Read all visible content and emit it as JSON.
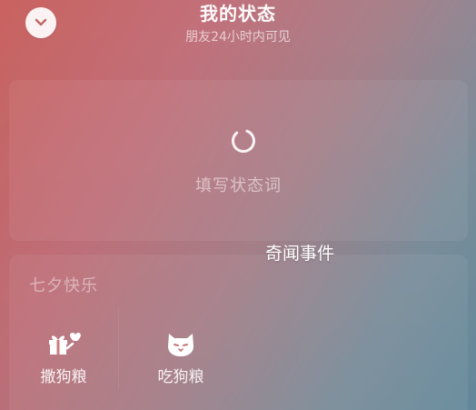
{
  "header": {
    "title": "我的状态",
    "subtitle": "朋友24小时内可见"
  },
  "collapse_button": {
    "icon": "chevron-down-icon"
  },
  "status_card": {
    "placeholder": "填写状态词",
    "icon": "loading-spinner-icon"
  },
  "watermark": "奇闻事件",
  "festival": {
    "title": "七夕快乐",
    "actions": [
      {
        "label": "撒狗粮",
        "icon": "gift-heart-icon"
      },
      {
        "label": "吃狗粮",
        "icon": "dog-face-icon"
      }
    ]
  },
  "colors": {
    "gradient_start": "#c9625f",
    "gradient_end": "#658c9f",
    "button_bg": "#ffffff",
    "chevron": "#c06a6a"
  }
}
